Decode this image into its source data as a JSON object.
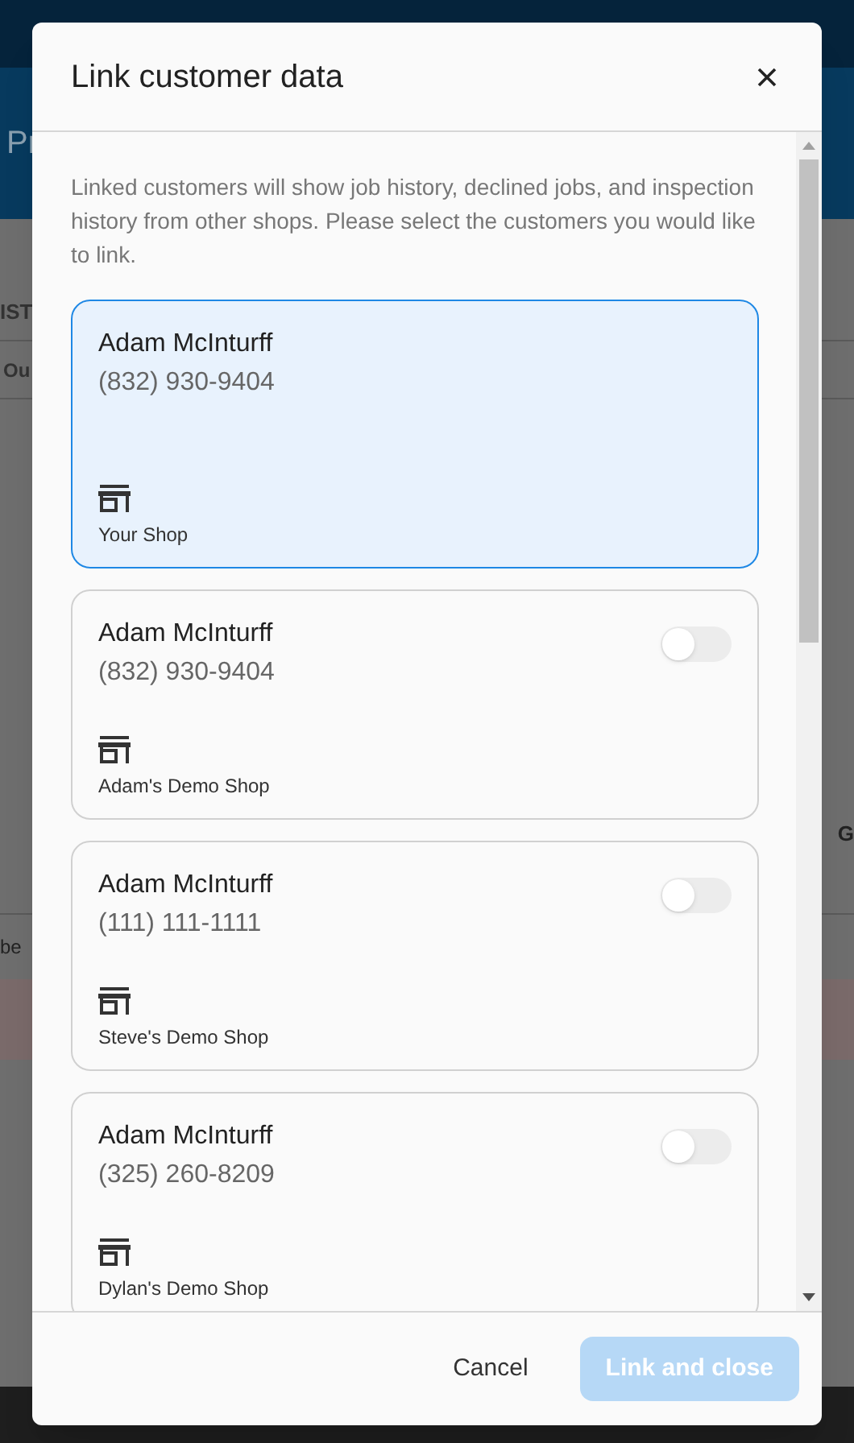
{
  "background": {
    "header_text": "Pr",
    "section_label": "IST",
    "column_label": "Ou",
    "row_text": "be",
    "right_text": "G"
  },
  "dialog": {
    "title": "Link customer data",
    "intro": "Linked customers will show job history, declined jobs, and inspection history from other shops. Please select the customers you would like to link.",
    "customers": [
      {
        "name": "Adam McInturff",
        "phone": "(832) 930-9404",
        "shop": "Your Shop",
        "kind": "own",
        "selected": true
      },
      {
        "name": "Adam McInturff",
        "phone": "(832) 930-9404",
        "shop": "Adam's Demo Shop",
        "kind": "other",
        "on": false
      },
      {
        "name": "Adam McInturff",
        "phone": "(111) 111-1111",
        "shop": "Steve's Demo Shop",
        "kind": "other",
        "on": false
      },
      {
        "name": "Adam McInturff",
        "phone": "(325) 260-8209",
        "shop": "Dylan's Demo Shop",
        "kind": "other",
        "on": false
      }
    ],
    "cancel": "Cancel",
    "confirm": {
      "label": "Link and close",
      "disabled": true
    }
  }
}
